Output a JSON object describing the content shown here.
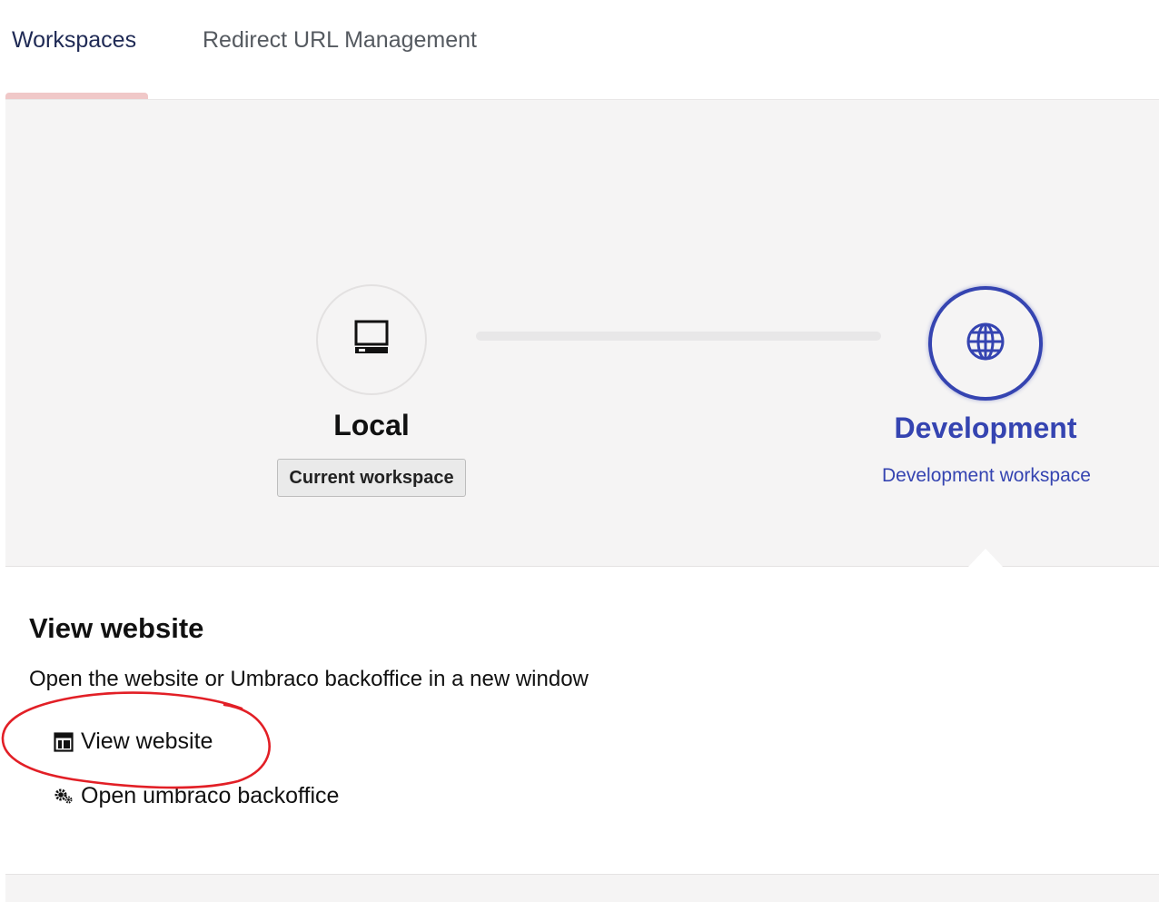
{
  "tabs": {
    "items": [
      {
        "label": "Workspaces",
        "active": true
      },
      {
        "label": "Redirect URL Management",
        "active": false
      }
    ]
  },
  "workspaces": {
    "local": {
      "title": "Local",
      "badge": "Current workspace",
      "icon": "computer-icon"
    },
    "development": {
      "title": "Development",
      "subtitle": "Development workspace",
      "icon": "globe-icon"
    }
  },
  "content": {
    "title": "View website",
    "description": "Open the website or Umbraco backoffice in a new window",
    "links": [
      {
        "label": "View website",
        "icon": "window-icon"
      },
      {
        "label": "Open umbraco backoffice",
        "icon": "gears-icon"
      }
    ]
  },
  "colors": {
    "accent": "#3544b1",
    "tab_indicator": "#f0c8c8",
    "panel_bg": "#f5f4f4",
    "annotation": "#e21f26"
  }
}
